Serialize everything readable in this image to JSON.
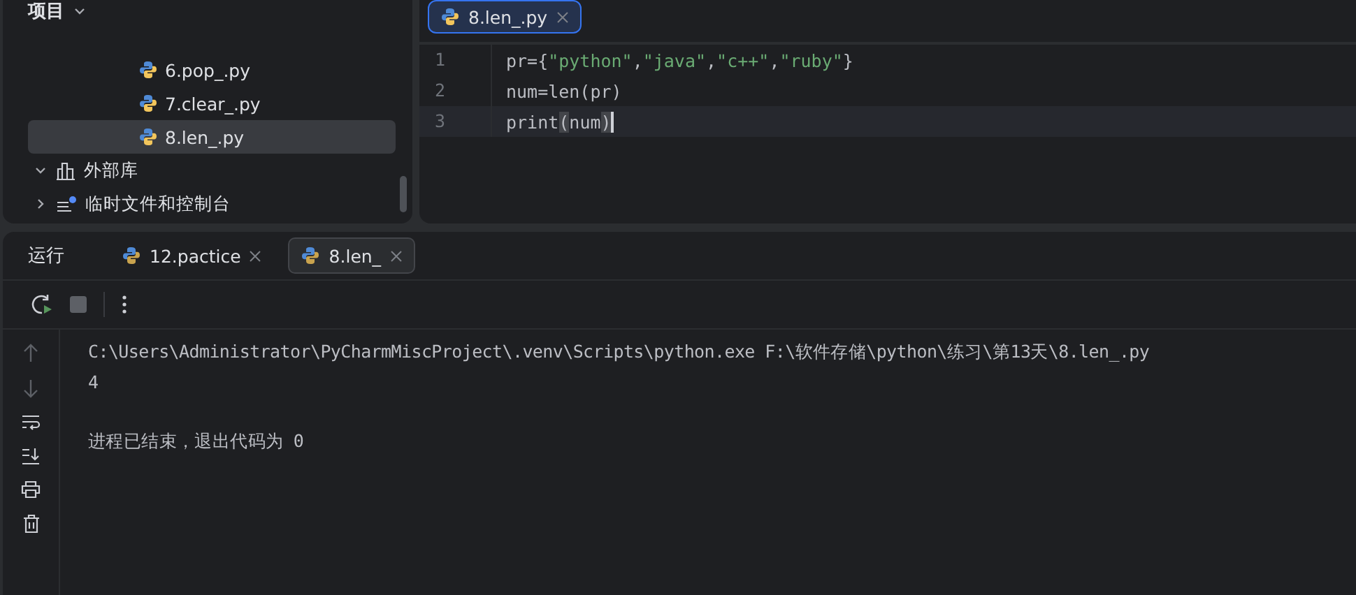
{
  "project_panel": {
    "title": "项目",
    "items": [
      {
        "kind": "file",
        "label": "6.pop_.py",
        "selected": false
      },
      {
        "kind": "file",
        "label": "7.clear_.py",
        "selected": false
      },
      {
        "kind": "file",
        "label": "8.len_.py",
        "selected": true
      },
      {
        "kind": "library",
        "label": "外部库",
        "expanded": true
      },
      {
        "kind": "scratch",
        "label": "临时文件和控制台",
        "expanded": false
      }
    ]
  },
  "editor": {
    "tabs": [
      {
        "label": "8.len_.py",
        "selected": true
      }
    ],
    "lines": [
      {
        "number": "1",
        "current": false,
        "tokens": [
          {
            "kind": "plain",
            "text": "pr={"
          },
          {
            "kind": "string",
            "text": "\"python\""
          },
          {
            "kind": "plain",
            "text": ","
          },
          {
            "kind": "string",
            "text": "\"java\""
          },
          {
            "kind": "plain",
            "text": ","
          },
          {
            "kind": "string",
            "text": "\"c++\""
          },
          {
            "kind": "plain",
            "text": ","
          },
          {
            "kind": "string",
            "text": "\"ruby\""
          },
          {
            "kind": "plain",
            "text": "}"
          }
        ]
      },
      {
        "number": "2",
        "current": false,
        "tokens": [
          {
            "kind": "plain",
            "text": "num=len(pr)"
          }
        ]
      },
      {
        "number": "3",
        "current": true,
        "tokens": [
          {
            "kind": "plain",
            "text": "print"
          },
          {
            "kind": "brace",
            "text": "("
          },
          {
            "kind": "plain",
            "text": "num"
          },
          {
            "kind": "brace",
            "text": ")"
          }
        ]
      }
    ]
  },
  "run_panel": {
    "title": "运行",
    "tabs": [
      {
        "label": "12.pactice",
        "selected": false
      },
      {
        "label": "8.len_",
        "selected": true
      }
    ],
    "console": [
      {
        "kind": "output",
        "text": "C:\\Users\\Administrator\\PyCharmMiscProject\\.venv\\Scripts\\python.exe F:\\软件存储\\python\\练习\\第13天\\8.len_.py"
      },
      {
        "kind": "output",
        "text": "4"
      },
      {
        "kind": "exit",
        "text": "进程已结束，退出代码为 0"
      }
    ]
  }
}
